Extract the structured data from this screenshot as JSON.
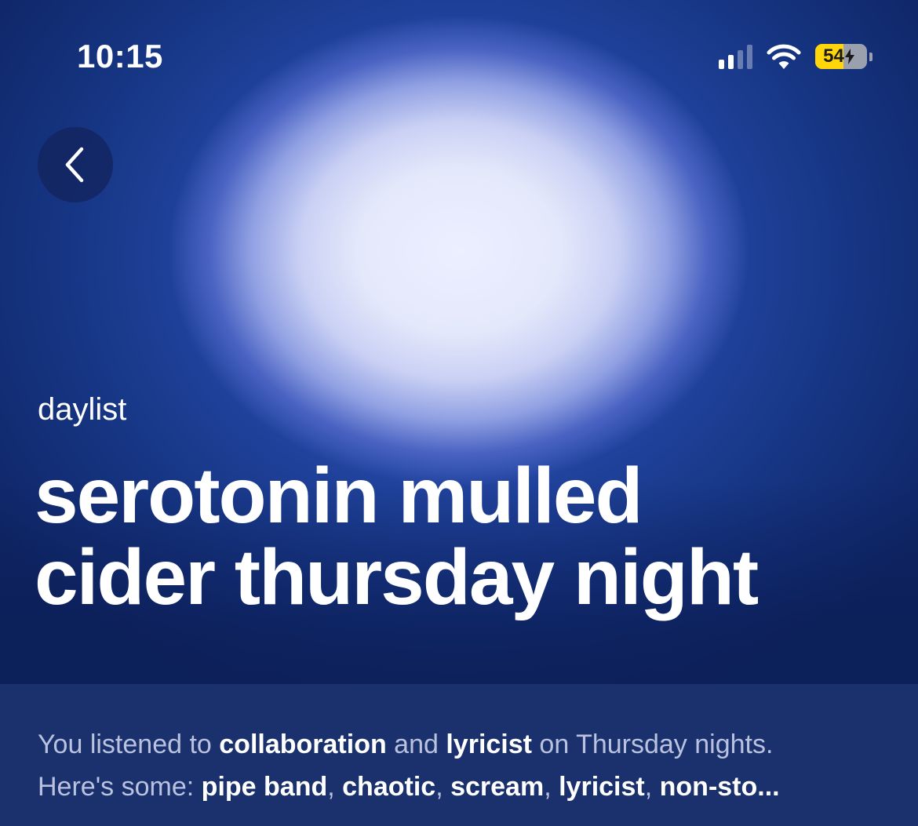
{
  "status_bar": {
    "time": "10:15",
    "battery_level": "54",
    "battery_fraction": 0.54,
    "signal_bars_active": 2,
    "signal_bars_total": 4,
    "icons": [
      "signal-icon",
      "wifi-icon",
      "battery-charging-icon"
    ]
  },
  "navigation": {
    "back_icon": "chevron-left-icon"
  },
  "playlist": {
    "type_label": "daylist",
    "title_line1": "serotonin mulled",
    "title_line2": "cider thursday night"
  },
  "description": {
    "l1_a": "You listened to ",
    "l1_b": "collaboration",
    "l1_c": " and ",
    "l1_d": "lyricist",
    "l1_e": " on Thursday nights.",
    "l2_a": "Here's some: ",
    "l2_b": "pipe band",
    "l2_c": ", ",
    "l2_d": "chaotic",
    "l2_e": ", ",
    "l2_f": "scream",
    "l2_g": ", ",
    "l2_h": "lyricist",
    "l2_i": ", ",
    "l2_j": "non-sto..."
  },
  "colors": {
    "accent_yellow": "#ffd60a",
    "hero_blue": "#1e3a96",
    "panel_blue": "#1b316d"
  }
}
